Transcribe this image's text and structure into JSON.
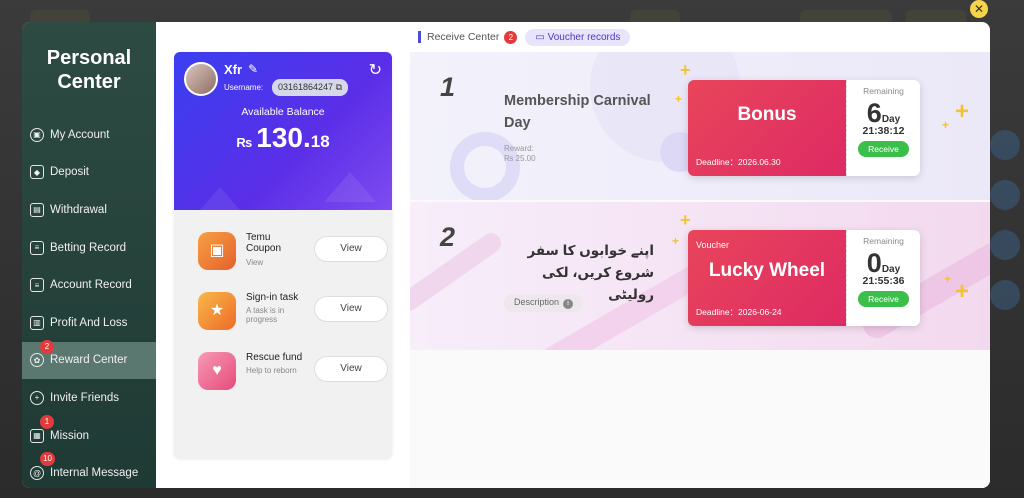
{
  "sidebar": {
    "title_line1": "Personal",
    "title_line2": "Center",
    "items": [
      {
        "label": "My Account",
        "badge": ""
      },
      {
        "label": "Deposit",
        "badge": ""
      },
      {
        "label": "Withdrawal",
        "badge": ""
      },
      {
        "label": "Betting Record",
        "badge": ""
      },
      {
        "label": "Account Record",
        "badge": ""
      },
      {
        "label": "Profit And Loss",
        "badge": ""
      },
      {
        "label": "Reward Center",
        "badge": "2"
      },
      {
        "label": "Invite Friends",
        "badge": ""
      },
      {
        "label": "Mission",
        "badge": "1"
      },
      {
        "label": "Internal Message",
        "badge": "10"
      }
    ]
  },
  "profile": {
    "username": "Xfr",
    "username_label": "Username:",
    "username_value": "03161864247",
    "balance_label": "Available Balance",
    "currency": "₨",
    "balance_int": "130.",
    "balance_dec": "18"
  },
  "tasks": [
    {
      "title": "Temu Coupon",
      "subtitle": "View",
      "button": "View"
    },
    {
      "title": "Sign-in task",
      "subtitle": "A task is in progress",
      "button": "View"
    },
    {
      "title": "Rescue fund",
      "subtitle": "Help to reborn",
      "button": "View"
    }
  ],
  "tabs": {
    "receive_center": "Receive Center",
    "receive_badge": "2",
    "voucher_records": "Voucher records"
  },
  "rewards": [
    {
      "index": "1",
      "title": "Membership Carnival Day",
      "reward_label": "Reward:",
      "reward_value": "₨ 25.00",
      "voucher_tag": "",
      "ticket_name": "Bonus",
      "deadline": "Deadline：2026.06.30",
      "remaining_label": "Remaining",
      "days": "6",
      "day_unit": "Day",
      "time": "21:38:12",
      "receive": "Receive"
    },
    {
      "index": "2",
      "title": "اپنے خوابوں کا سفر شروع کریں، لکی رولیٹی",
      "description": "Description",
      "voucher_tag": "Voucher",
      "ticket_name": "Lucky Wheel",
      "deadline": "Deadline：2026-06-24",
      "remaining_label": "Remaining",
      "days": "0",
      "day_unit": "Day",
      "time": "21:55:36",
      "receive": "Receive"
    }
  ],
  "colors": {
    "sidebar": "#2d4b43",
    "balance_card": "#4b35ec",
    "ticket": "#e3385f",
    "receive": "#3bbf4a",
    "badge": "#e33b3b"
  }
}
